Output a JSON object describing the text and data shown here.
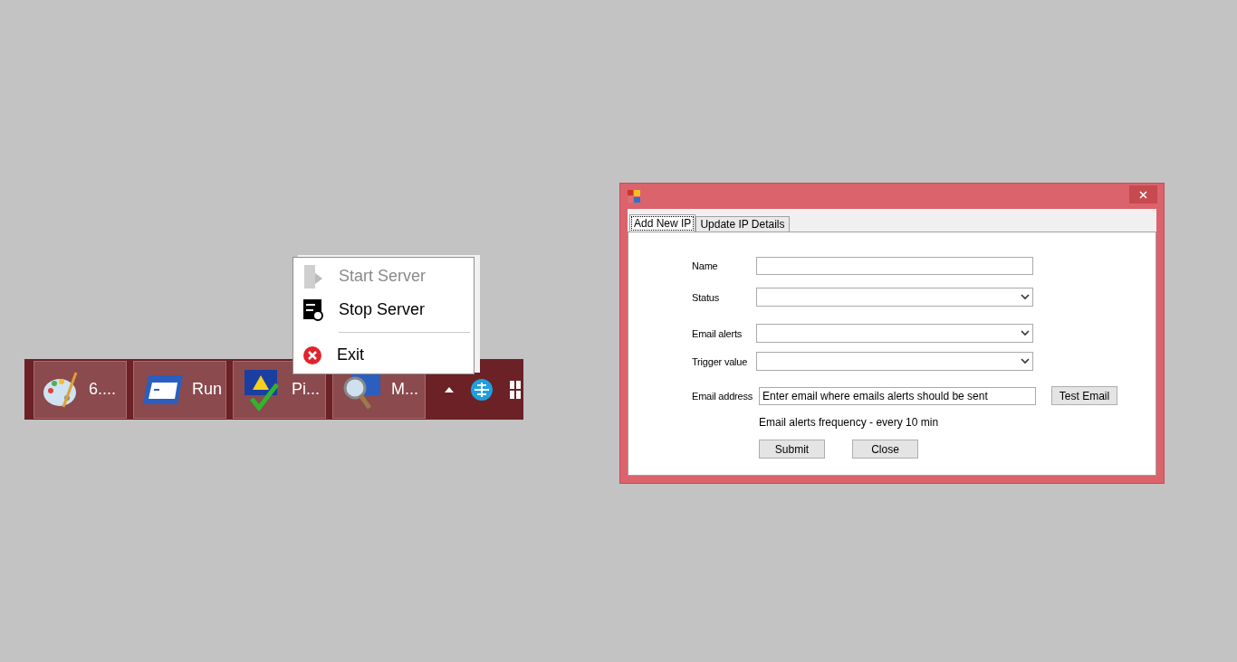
{
  "taskbar": {
    "buttons": [
      {
        "label": "6...."
      },
      {
        "label": "Run"
      },
      {
        "label": "Pi..."
      },
      {
        "label": "M..."
      }
    ]
  },
  "context_menu": {
    "items": [
      {
        "kind": "item",
        "label": "Start Server",
        "disabled": true
      },
      {
        "kind": "item",
        "label": "Stop Server",
        "disabled": false
      },
      {
        "kind": "separator"
      },
      {
        "kind": "item",
        "label": "Exit",
        "disabled": false
      }
    ]
  },
  "dialog": {
    "tabs": [
      {
        "label": "Add New IP",
        "selected": true
      },
      {
        "label": "Update IP Details",
        "selected": false
      }
    ],
    "fields": [
      {
        "kind": "text",
        "label": "Name"
      },
      {
        "kind": "select",
        "label": "Status"
      },
      {
        "kind": "select",
        "label": "Email alerts"
      },
      {
        "kind": "select",
        "label": "Trigger value"
      },
      {
        "kind": "text",
        "label": "Email address",
        "value": "Enter email where emails alerts should be sent",
        "button": "Test Email"
      }
    ],
    "note": "Email alerts frequency - every 10 min",
    "buttons": [
      "Submit",
      "Close"
    ]
  }
}
